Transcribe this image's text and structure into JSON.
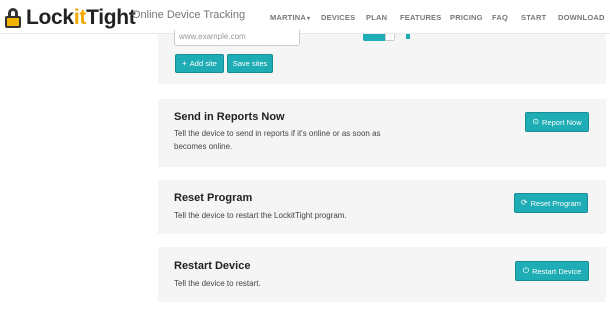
{
  "brand": {
    "name_prefix": "Lock",
    "name_mid": "it",
    "name_suffix": "Tight",
    "tagline": "Online Device Tracking"
  },
  "nav": {
    "user_menu": "MARTINA",
    "items": [
      "DEVICES",
      "PLAN",
      "FEATURES",
      "PRICING",
      "FAQ",
      "START",
      "DOWNLOAD"
    ]
  },
  "sites": {
    "url_placeholder": "www.example.com",
    "add_label": "Add site",
    "save_label": "Save sites"
  },
  "sections": [
    {
      "title": "Send in Reports Now",
      "desc_line1": "Tell the device to send in reports if it's online or as soon as",
      "desc_line2": "becomes online.",
      "button": "Report Now"
    },
    {
      "title": "Reset Program",
      "desc_line1": "Tell the device to restart the LockitTight program.",
      "button": "Reset Program"
    },
    {
      "title": "Restart Device",
      "desc_line1": "Tell the device to restart.",
      "button": "Restart Device"
    }
  ],
  "colors": {
    "accent": "#1eacb5",
    "panel_bg": "#f5f5f5",
    "brand_yellow": "#f0a800"
  }
}
